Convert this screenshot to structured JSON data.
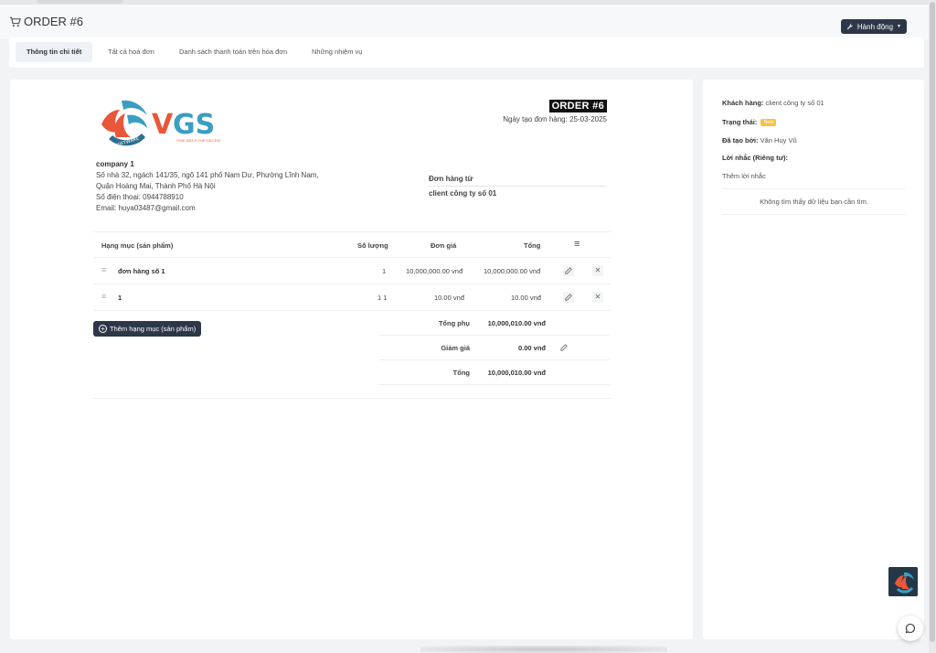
{
  "header": {
    "title": "ORDER #6",
    "cart_icon": "cart-icon",
    "action_label": "Hành động",
    "action_icon": "wrench-icon"
  },
  "tabs": [
    {
      "label": "Thông tin chi tiết",
      "active": true
    },
    {
      "label": "Tất cả hoá đơn",
      "active": false
    },
    {
      "label": "Danh sách thanh toán trên hóa đơn",
      "active": false
    },
    {
      "label": "Những nhiệm vụ",
      "active": false
    }
  ],
  "logo": {
    "text": "VGS",
    "tagline": "YOUR IDEA IS OUR SUCCESS",
    "ribbon": "SOFTWARE",
    "colors": {
      "orange": "#e8573a",
      "blue": "#3a9ec2"
    }
  },
  "order": {
    "badge": "ORDER #6",
    "date": "Ngày tạo đơn hàng: 25-03-2025"
  },
  "company": {
    "name": "company 1",
    "address_line1": "Số nhà 32, ngách 141/35, ngõ 141 phố Nam Dư, Phường Lĩnh Nam,",
    "address_line2": "Quận Hoàng Mai, Thành Phố Hà Nội",
    "phone": "Số điện thoại: 0944788910",
    "email": "Email: huya03487@gmail.com"
  },
  "from": {
    "label": "Đơn hàng từ",
    "value": "client công ty số 01"
  },
  "table": {
    "headers": {
      "item": "Hạng mục (sản phẩm)",
      "qty": "Số lượng",
      "price": "Đơn giá",
      "total": "Tổng"
    },
    "rows": [
      {
        "name": "đơn hàng số 1",
        "qty": "1",
        "price": "10,000,000.00 vnđ",
        "total": "10,000,000.00 vnđ"
      },
      {
        "name": "1",
        "qty": "1 1",
        "price": "10.00 vnđ",
        "total": "10.00 vnđ"
      }
    ]
  },
  "add_item_label": "Thêm hạng mục (sản phẩm)",
  "summary": {
    "subtotal_label": "Tổng phụ",
    "subtotal": "10,000,010.00 vnđ",
    "discount_label": "Giảm giá",
    "discount": "0.00 vnđ",
    "total_label": "Tổng",
    "total": "10,000,010.00 vnđ"
  },
  "sidebar": {
    "customer_label": "Khách hàng:",
    "customer": "client công ty số 01",
    "status_label": "Trạng thái:",
    "status": "New",
    "status_color": "#f6c343",
    "created_by_label": "Đã tạo bởi:",
    "created_by": "Văn Huy Vũ",
    "reminder_label": "Lời nhắc (Riêng tư):",
    "add_reminder": "Thêm lời nhắc",
    "empty_message": "Không tìm thấy dữ liệu bạn cần tìm."
  },
  "accent": "#2d3748"
}
